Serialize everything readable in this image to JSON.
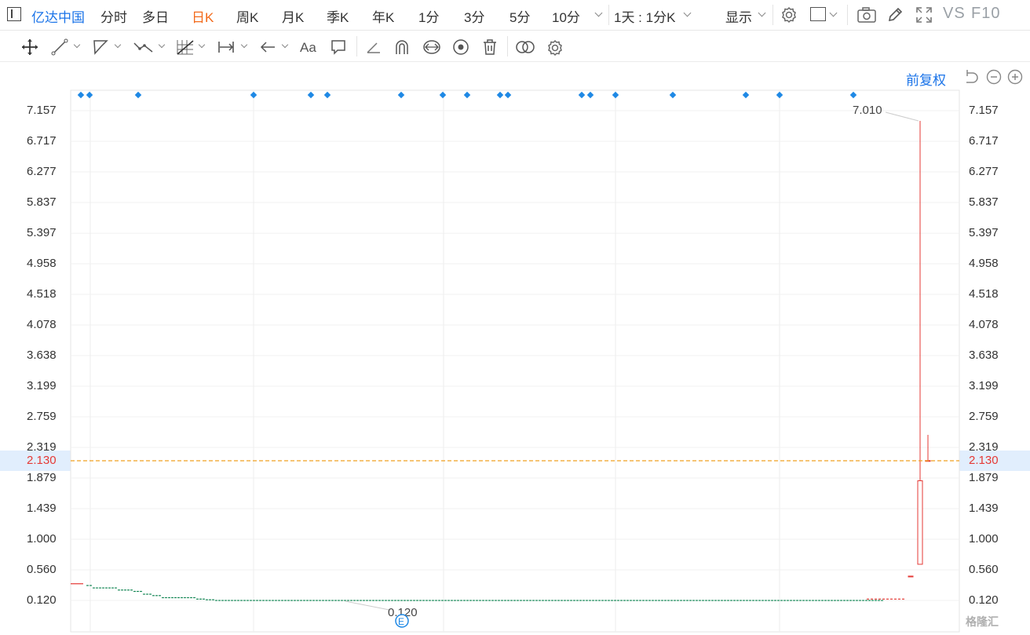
{
  "header": {
    "stock_name": "亿达中国",
    "tabs": [
      "分时",
      "多日",
      "日K",
      "周K",
      "月K",
      "季K",
      "年K",
      "1分",
      "3分",
      "5分",
      "10分"
    ],
    "active_tab": "日K",
    "range_label": "1天 : 1分K",
    "display_label": "显示",
    "vs_label": "VS",
    "f10_label": "F10"
  },
  "colors": {
    "accent": "#1a73e8",
    "active_tab": "#f26a1b",
    "up": "#e53935",
    "down": "#1b8a5a",
    "current_line": "#f0a020",
    "marker": "#1e88e5"
  },
  "chart": {
    "adjust_label": "前复权",
    "y_ticks": [
      "7.157",
      "6.717",
      "6.277",
      "5.837",
      "5.397",
      "4.958",
      "4.518",
      "4.078",
      "3.638",
      "3.199",
      "2.759",
      "2.319",
      "1.879",
      "1.439",
      "1.000",
      "0.560",
      "0.120"
    ],
    "current_price": "2.130",
    "high_label": "7.010",
    "low_label": "0.120",
    "event_marker": "E",
    "watermark": "格隆汇"
  },
  "chart_data": {
    "type": "candlestick",
    "current_price": 2.13,
    "high": 7.01,
    "low": 0.12,
    "ylim": [
      0.12,
      7.157
    ],
    "y_ticks": [
      7.157,
      6.717,
      6.277,
      5.837,
      5.397,
      4.958,
      4.518,
      4.078,
      3.638,
      3.199,
      2.759,
      2.319,
      1.879,
      1.439,
      1.0,
      0.56,
      0.12
    ],
    "series": [
      {
        "name": "",
        "values": [
          0.335,
          0.335,
          0.3,
          0.3,
          0.3,
          0.3,
          0.3,
          0.3,
          0.3,
          0.3,
          0.27,
          0.27,
          0.27,
          0.27,
          0.27,
          0.25,
          0.25,
          0.25,
          0.21,
          0.21,
          0.21,
          0.19,
          0.19,
          0.19,
          0.16,
          0.16,
          0.16,
          0.16,
          0.16,
          0.16,
          0.16,
          0.16,
          0.16,
          0.16,
          0.16,
          0.14,
          0.14,
          0.14,
          0.13,
          0.13,
          0.13,
          0.12,
          0.12,
          0.12,
          0.12,
          0.12,
          0.12,
          0.12,
          0.12,
          0.12,
          0.12,
          0.12,
          0.12,
          0.12,
          0.12,
          0.12,
          0.12,
          0.12,
          0.12,
          0.12,
          0.12,
          0.12,
          0.12,
          0.12,
          0.12,
          0.12,
          0.12,
          0.12,
          0.12,
          0.12,
          0.12,
          0.12,
          0.12,
          0.12,
          0.12,
          0.12,
          0.12,
          0.12,
          0.12,
          0.12,
          0.12,
          0.12,
          0.12,
          0.12,
          0.12,
          0.12,
          0.12,
          0.12,
          0.12,
          0.12,
          0.12,
          0.12,
          0.12,
          0.12,
          0.12,
          0.12,
          0.12,
          0.12,
          0.12,
          0.12,
          0.12,
          0.12,
          0.12,
          0.12,
          0.12,
          0.12,
          0.12,
          0.12,
          0.12,
          0.12,
          0.12,
          0.12,
          0.12,
          0.12,
          0.12,
          0.12,
          0.12,
          0.12,
          0.12,
          0.12,
          0.12,
          0.12,
          0.12,
          0.12,
          0.12,
          0.12,
          0.12,
          0.12,
          0.12,
          0.12,
          0.12,
          0.12,
          0.12,
          0.12,
          0.12,
          0.12,
          0.12,
          0.12,
          0.12,
          0.12,
          0.12,
          0.12,
          0.12,
          0.12,
          0.12,
          0.12,
          0.12,
          0.12,
          0.12,
          0.12,
          0.12,
          0.12,
          0.12,
          0.12,
          0.12,
          0.12,
          0.12,
          0.12,
          0.12,
          0.12,
          0.12,
          0.12,
          0.12,
          0.12,
          0.12,
          0.12,
          0.12,
          0.12,
          0.12,
          0.12,
          0.12,
          0.12,
          0.12,
          0.12,
          0.12,
          0.12,
          0.12,
          0.12,
          0.12,
          0.12,
          0.12,
          0.12,
          0.12,
          0.12,
          0.12,
          0.12,
          0.12,
          0.12,
          0.12,
          0.12,
          0.12,
          0.12,
          0.12,
          0.12,
          0.12,
          0.12,
          0.12,
          0.12,
          0.12,
          0.12,
          0.12,
          0.12,
          0.12,
          0.12,
          0.12,
          0.12,
          0.12,
          0.12,
          0.12,
          0.12,
          0.12,
          0.12,
          0.12,
          0.12,
          0.12,
          0.12,
          0.12,
          0.12,
          0.12,
          0.12,
          0.12,
          0.12,
          0.12,
          0.12,
          0.12,
          0.12,
          0.12,
          0.12,
          0.12,
          0.12,
          0.12,
          0.12,
          0.12,
          0.12,
          0.12,
          0.12,
          0.12,
          0.12,
          0.12,
          0.12,
          0.12,
          0.12,
          0.12,
          0.12,
          0.12,
          0.12,
          0.12,
          0.12,
          0.12,
          0.12,
          0.12,
          0.12,
          0.12,
          0.12
        ]
      },
      {
        "name": "",
        "values": [
          0.14,
          0.14,
          0.14,
          0.14,
          0.14,
          0.14,
          0.14,
          0.14,
          0.14,
          0.14
        ]
      }
    ],
    "candles": [
      {
        "open": 0.47,
        "close": 0.47,
        "high": 0.47,
        "low": 0.47
      },
      {
        "open": 0.64,
        "close": 1.84,
        "high": 7.01,
        "low": 0.64
      },
      {
        "open": 2.13,
        "close": 2.13,
        "high": 2.5,
        "low": 2.13
      }
    ],
    "event_markers": [
      "E"
    ]
  }
}
